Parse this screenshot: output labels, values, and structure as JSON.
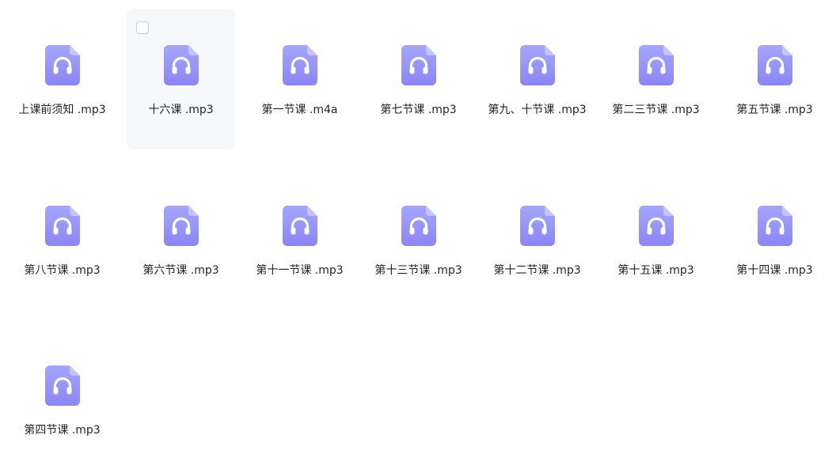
{
  "files": [
    {
      "name": "上课前须知 .mp3",
      "icon": "audio-file-icon"
    },
    {
      "name": "十六课 .mp3",
      "icon": "audio-file-icon",
      "hovered": true
    },
    {
      "name": "第一节课 .m4a",
      "icon": "audio-file-icon"
    },
    {
      "name": "第七节课 .mp3",
      "icon": "audio-file-icon"
    },
    {
      "name": "第九、十节课 .mp3",
      "icon": "audio-file-icon"
    },
    {
      "name": "第二三节课 .mp3",
      "icon": "audio-file-icon"
    },
    {
      "name": "第五节课 .mp3",
      "icon": "audio-file-icon"
    },
    {
      "name": "第八节课 .mp3",
      "icon": "audio-file-icon"
    },
    {
      "name": "第六节课 .mp3",
      "icon": "audio-file-icon"
    },
    {
      "name": "第十一节课 .mp3",
      "icon": "audio-file-icon"
    },
    {
      "name": "第十三节课 .mp3",
      "icon": "audio-file-icon"
    },
    {
      "name": "第十二节课 .mp3",
      "icon": "audio-file-icon"
    },
    {
      "name": "第十五课 .mp3",
      "icon": "audio-file-icon"
    },
    {
      "name": "第十四课 .mp3",
      "icon": "audio-file-icon"
    },
    {
      "name": "第四节课 .mp3",
      "icon": "audio-file-icon"
    }
  ],
  "colors": {
    "icon_top": "#a4a6ff",
    "icon_bottom": "#8a86f5",
    "icon_fold": "#c4c5ff",
    "headphones": "#ffffff",
    "text": "#1f2329",
    "hover_bg": "#f6f8fc"
  }
}
